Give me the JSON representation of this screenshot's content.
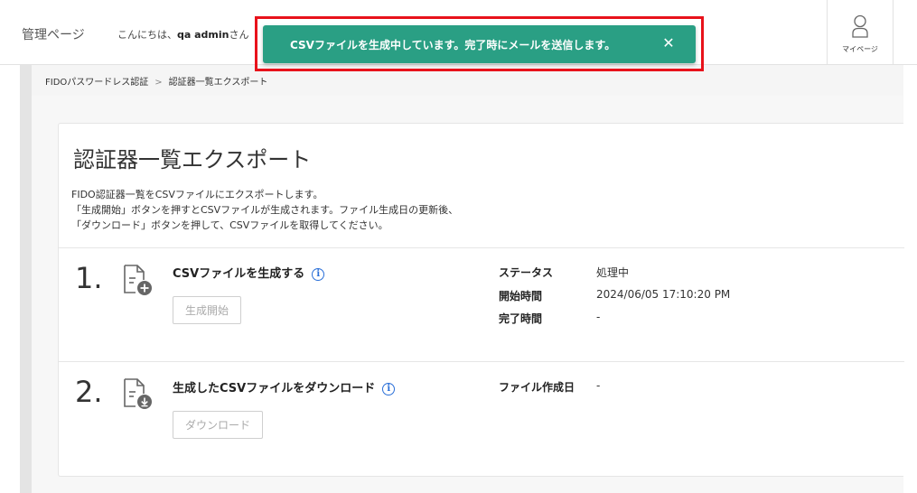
{
  "header": {
    "app_title": "管理ページ",
    "greeting_prefix": "こんにちは、",
    "user_name": "qa admin",
    "greeting_suffix": "さん",
    "mypage_label": "マイページ"
  },
  "toast": {
    "message": "CSVファイルを生成中しています。完了時にメールを送信します。",
    "close_label": "✕",
    "color": "#2a9f84",
    "highlight_color": "#e8121b"
  },
  "breadcrumb": {
    "parent": "FIDOパスワードレス認証",
    "separator": ">",
    "current": "認証器一覧エクスポート"
  },
  "page": {
    "title": "認証器一覧エクスポート",
    "description": [
      "FIDO認証器一覧をCSVファイルにエクスポートします。",
      "「生成開始」ボタンを押すとCSVファイルが生成されます。ファイル生成日の更新後、",
      "「ダウンロード」ボタンを押して、CSVファイルを取得してください。"
    ]
  },
  "steps": [
    {
      "number": "1.",
      "icon": "file-add-icon",
      "title": "CSVファイルを生成する",
      "info_icon": "info-icon",
      "button_label": "生成開始",
      "fields": [
        {
          "label": "ステータス",
          "value": "処理中"
        },
        {
          "label": "開始時間",
          "value": "2024/06/05 17:10:20 PM"
        },
        {
          "label": "完了時間",
          "value": "-"
        }
      ]
    },
    {
      "number": "2.",
      "icon": "file-download-icon",
      "title": "生成したCSVファイルをダウンロード",
      "info_icon": "info-icon",
      "button_label": "ダウンロード",
      "fields": [
        {
          "label": "ファイル作成日",
          "value": "-"
        }
      ]
    }
  ]
}
